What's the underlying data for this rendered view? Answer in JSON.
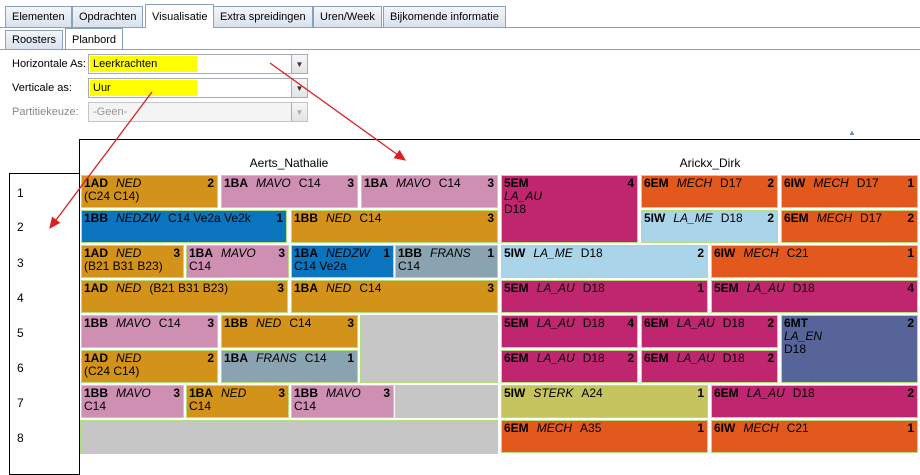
{
  "tabs": [
    "Elementen",
    "Opdrachten",
    "Visualisatie",
    "Extra spreidingen",
    "Uren/Week",
    "Bijkomende informatie"
  ],
  "subtabs": [
    "Roosters",
    "Planbord"
  ],
  "form": {
    "horizontal_label": "Horizontale As:",
    "horizontal_value": "Leerkrachten",
    "vertical_label": "Verticale as:",
    "vertical_value": "Uur",
    "partition_label": "Partitiekeuze:",
    "partition_value": "-Geen-"
  },
  "teachers": [
    "Aerts_Nathalie",
    "Arickx_Dirk"
  ],
  "rows": [
    "1",
    "2",
    "3",
    "4",
    "5",
    "6",
    "7",
    "8"
  ],
  "cells": [
    {
      "code": "1AD",
      "subj": "NED",
      "room": "",
      "num": "2",
      "l2": "(C24 C14)",
      "l3": ""
    },
    {
      "code": "1BA",
      "subj": "MAVO",
      "room": "C14",
      "num": "3",
      "l2": "",
      "l3": ""
    },
    {
      "code": "1BA",
      "subj": "MAVO",
      "room": "C14",
      "num": "3",
      "l2": "",
      "l3": ""
    },
    {
      "code": "5EM",
      "subj": "",
      "room": "",
      "num": "4",
      "l2": "LA_AU",
      "l3": "D18"
    },
    {
      "code": "6EM",
      "subj": "MECH",
      "room": "D17",
      "num": "2",
      "l2": "",
      "l3": ""
    },
    {
      "code": "6IW",
      "subj": "MECH",
      "room": "D17",
      "num": "1",
      "l2": "",
      "l3": ""
    },
    {
      "code": "1BB",
      "subj": "NEDZW",
      "room": "C14  Ve2a  Ve2k",
      "num": "1",
      "l2": "",
      "l3": ""
    },
    {
      "code": "1BB",
      "subj": "NED",
      "room": "C14",
      "num": "3",
      "l2": "",
      "l3": ""
    },
    {
      "code": "5IW",
      "subj": "LA_ME",
      "room": "D18",
      "num": "2",
      "l2": "",
      "l3": ""
    },
    {
      "code": "6EM",
      "subj": "MECH",
      "room": "D17",
      "num": "2",
      "l2": "",
      "l3": ""
    },
    {
      "code": "1AD",
      "subj": "NED",
      "room": "",
      "num": "3",
      "l2": "(B21 B31 B23)",
      "l3": ""
    },
    {
      "code": "1BA",
      "subj": "MAVO",
      "room": "",
      "num": "3",
      "l2": "C14",
      "l3": ""
    },
    {
      "code": "1BA",
      "subj": "NEDZW",
      "room": "",
      "num": "1",
      "l2": "C14  Ve2a",
      "l3": ""
    },
    {
      "code": "1BB",
      "subj": "FRANS",
      "room": "",
      "num": "1",
      "l2": "C14",
      "l3": ""
    },
    {
      "code": "5IW",
      "subj": "LA_ME",
      "room": "D18",
      "num": "2",
      "l2": "",
      "l3": ""
    },
    {
      "code": "6IW",
      "subj": "MECH",
      "room": "C21",
      "num": "1",
      "l2": "",
      "l3": ""
    },
    {
      "code": "1AD",
      "subj": "NED",
      "room": "(B21 B31 B23)",
      "num": "3",
      "l2": "",
      "l3": ""
    },
    {
      "code": "1BA",
      "subj": "NED",
      "room": "C14",
      "num": "3",
      "l2": "",
      "l3": ""
    },
    {
      "code": "5EM",
      "subj": "LA_AU",
      "room": "D18",
      "num": "1",
      "l2": "",
      "l3": ""
    },
    {
      "code": "5EM",
      "subj": "LA_AU",
      "room": "D18",
      "num": "4",
      "l2": "",
      "l3": ""
    },
    {
      "code": "1BB",
      "subj": "MAVO",
      "room": "C14",
      "num": "3",
      "l2": "",
      "l3": ""
    },
    {
      "code": "1BB",
      "subj": "NED",
      "room": "C14",
      "num": "3",
      "l2": "",
      "l3": ""
    },
    {
      "code": "5EM",
      "subj": "LA_AU",
      "room": "D18",
      "num": "4",
      "l2": "",
      "l3": ""
    },
    {
      "code": "6EM",
      "subj": "LA_AU",
      "room": "D18",
      "num": "2",
      "l2": "",
      "l3": ""
    },
    {
      "code": "6MT",
      "subj": "",
      "room": "",
      "num": "2",
      "l2": "LA_EN",
      "l3": "D18"
    },
    {
      "code": "1AD",
      "subj": "NED",
      "room": "",
      "num": "2",
      "l2": "(C24 C14)",
      "l3": ""
    },
    {
      "code": "1BA",
      "subj": "FRANS",
      "room": "C14",
      "num": "1",
      "l2": "",
      "l3": ""
    },
    {
      "code": "6EM",
      "subj": "LA_AU",
      "room": "D18",
      "num": "2",
      "l2": "",
      "l3": ""
    },
    {
      "code": "6EM",
      "subj": "LA_AU",
      "room": "D18",
      "num": "2",
      "l2": "",
      "l3": ""
    },
    {
      "code": "1BB",
      "subj": "MAVO",
      "room": "",
      "num": "3",
      "l2": "C14",
      "l3": ""
    },
    {
      "code": "1BA",
      "subj": "NED",
      "room": "",
      "num": "3",
      "l2": "C14",
      "l3": ""
    },
    {
      "code": "1BB",
      "subj": "MAVO",
      "room": "",
      "num": "3",
      "l2": "C14",
      "l3": ""
    },
    {
      "code": "5IW",
      "subj": "STERK",
      "room": "A24",
      "num": "1",
      "l2": "",
      "l3": ""
    },
    {
      "code": "6EM",
      "subj": "LA_AU",
      "room": "D18",
      "num": "2",
      "l2": "",
      "l3": ""
    },
    {
      "code": "6EM",
      "subj": "MECH",
      "room": "A35",
      "num": "1",
      "l2": "",
      "l3": ""
    },
    {
      "code": "6IW",
      "subj": "MECH",
      "room": "C21",
      "num": "1",
      "l2": "",
      "l3": ""
    }
  ],
  "colors": {
    "orange_gold": "#d39219",
    "mauve": "#cf8fb3",
    "magenta": "#c0266f",
    "dark_orange": "#e2581d",
    "blue": "#0a74bf",
    "light_blue": "#a9d4ea",
    "steel": "#8aa3b0",
    "slate": "#56649a",
    "olive": "#c5c45e",
    "highlight_yellow": "#ffff00",
    "arrow_red": "#dd1f1f"
  }
}
